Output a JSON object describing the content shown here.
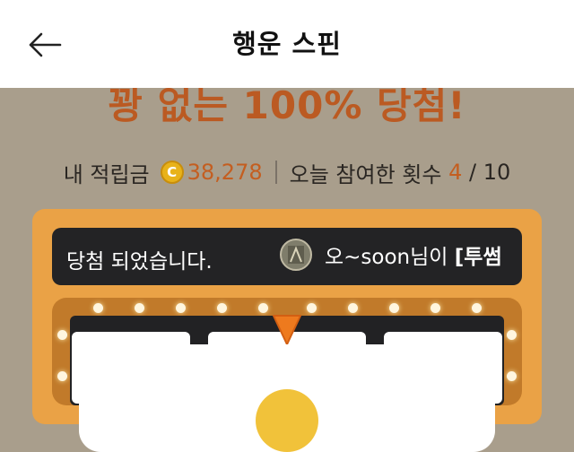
{
  "header": {
    "title": "행운 스핀",
    "back_icon": "arrow-left-icon"
  },
  "headline": "꽝 없는 100% 당첨!",
  "stats": {
    "points_label": "내 적립금",
    "coin_symbol": "C",
    "points_value": "38,278",
    "participation_label": "오늘 참여한 횟수",
    "participation_current": "4",
    "participation_separator": "/",
    "participation_max": "10"
  },
  "ticker": {
    "left_text": "당첨 되었습니다.",
    "right_user": "오~soon님이",
    "right_bold": "[투썸"
  },
  "colors": {
    "accent_orange": "#c45e20",
    "frame_orange": "#eaa246",
    "coin_gold": "#e8b21a"
  }
}
